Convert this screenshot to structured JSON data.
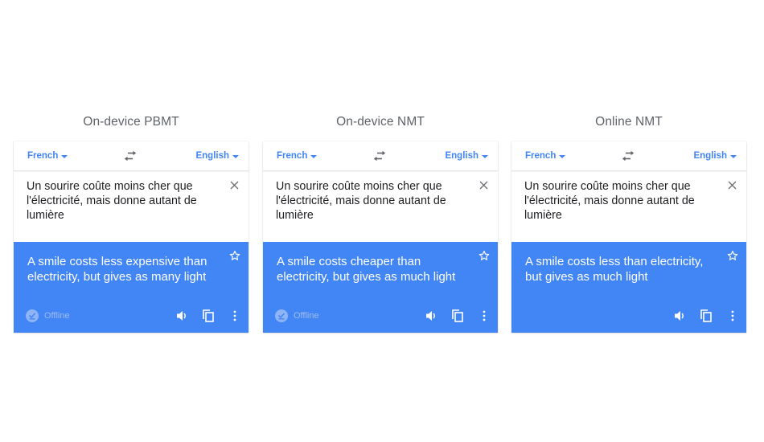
{
  "theme": {
    "accent": "#4285f4",
    "title_color": "#5f6368"
  },
  "panels": [
    {
      "title": "On-device PBMT",
      "source_lang": "French",
      "target_lang": "English",
      "source_text": "Un sourire coûte moins cher que l'électricité, mais donne autant de lumière",
      "translation": "A smile costs less expensive than electricity, but gives as many light",
      "offline_label": "Offline"
    },
    {
      "title": "On-device NMT",
      "source_lang": "French",
      "target_lang": "English",
      "source_text": "Un sourire coûte moins cher que l'électricité, mais donne autant de lumière",
      "translation": "A smile costs cheaper than electricity, but gives as much light",
      "offline_label": "Offline"
    },
    {
      "title": "Online NMT",
      "source_lang": "French",
      "target_lang": "English",
      "source_text": "Un sourire coûte moins cher que l'électricité, mais donne autant de lumière",
      "translation": "A smile costs less than electricity, but gives as much light",
      "offline_label": null
    }
  ],
  "icons": {
    "swap": "swap-languages-icon",
    "clear": "close-icon",
    "star": "star-outline-icon",
    "offline": "offline-check-icon",
    "speaker": "speaker-icon",
    "copy": "copy-icon",
    "more": "more-vert-icon"
  }
}
